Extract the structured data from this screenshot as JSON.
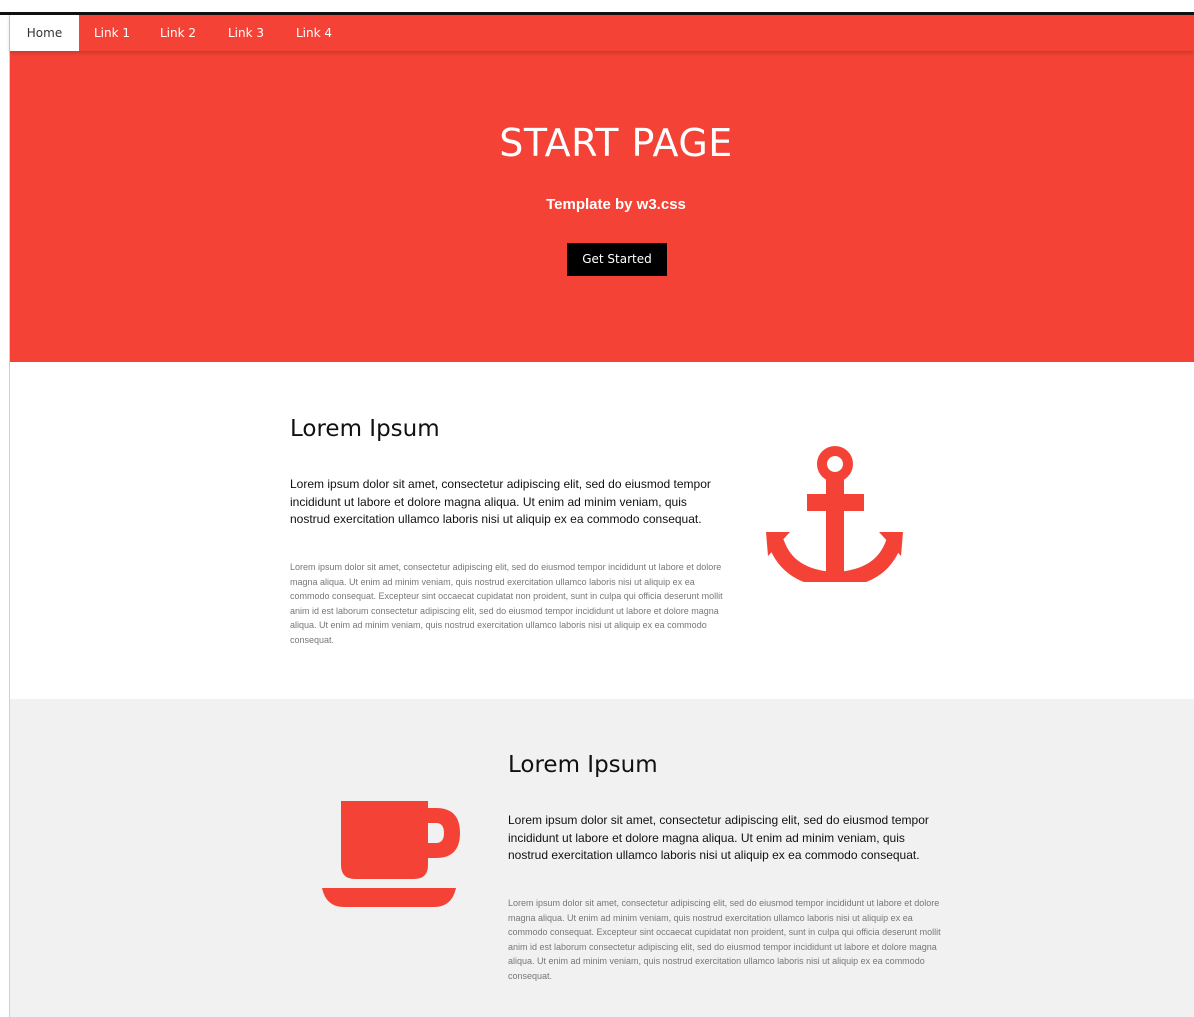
{
  "nav": {
    "items": [
      {
        "label": "Home",
        "active": true
      },
      {
        "label": "Link 1"
      },
      {
        "label": "Link 2"
      },
      {
        "label": "Link 3"
      },
      {
        "label": "Link 4"
      }
    ]
  },
  "hero": {
    "title": "START PAGE",
    "subtitle": "Template by w3.css",
    "button_label": "Get Started"
  },
  "sections": [
    {
      "heading": "Lorem Ipsum",
      "lead": "Lorem ipsum dolor sit amet, consectetur adipiscing elit, sed do eiusmod tempor incididunt ut labore et dolore magna aliqua. Ut enim ad minim veniam, quis nostrud exercitation ullamco laboris nisi ut aliquip ex ea commodo consequat.",
      "body": "Lorem ipsum dolor sit amet, consectetur adipiscing elit, sed do eiusmod tempor incididunt ut labore et dolore magna aliqua. Ut enim ad minim veniam, quis nostrud exercitation ullamco laboris nisi ut aliquip ex ea commodo consequat. Excepteur sint occaecat cupidatat non proident, sunt in culpa qui officia deserunt mollit anim id est laborum consectetur adipiscing elit, sed do eiusmod tempor incididunt ut labore et dolore magna aliqua. Ut enim ad minim veniam, quis nostrud exercitation ullamco laboris nisi ut aliquip ex ea commodo consequat.",
      "icon": "anchor-icon"
    },
    {
      "heading": "Lorem Ipsum",
      "lead": "Lorem ipsum dolor sit amet, consectetur adipiscing elit, sed do eiusmod tempor incididunt ut labore et dolore magna aliqua. Ut enim ad minim veniam, quis nostrud exercitation ullamco laboris nisi ut aliquip ex ea commodo consequat.",
      "body": "Lorem ipsum dolor sit amet, consectetur adipiscing elit, sed do eiusmod tempor incididunt ut labore et dolore magna aliqua. Ut enim ad minim veniam, quis nostrud exercitation ullamco laboris nisi ut aliquip ex ea commodo consequat. Excepteur sint occaecat cupidatat non proident, sunt in culpa qui officia deserunt mollit anim id est laborum consectetur adipiscing elit, sed do eiusmod tempor incididunt ut labore et dolore magna aliqua. Ut enim ad minim veniam, quis nostrud exercitation ullamco laboris nisi ut aliquip ex ea commodo consequat.",
      "icon": "coffee-cup-icon"
    }
  ],
  "colors": {
    "accent": "#f44336",
    "light_bg": "#f1f1f1",
    "button_bg": "#000000"
  }
}
